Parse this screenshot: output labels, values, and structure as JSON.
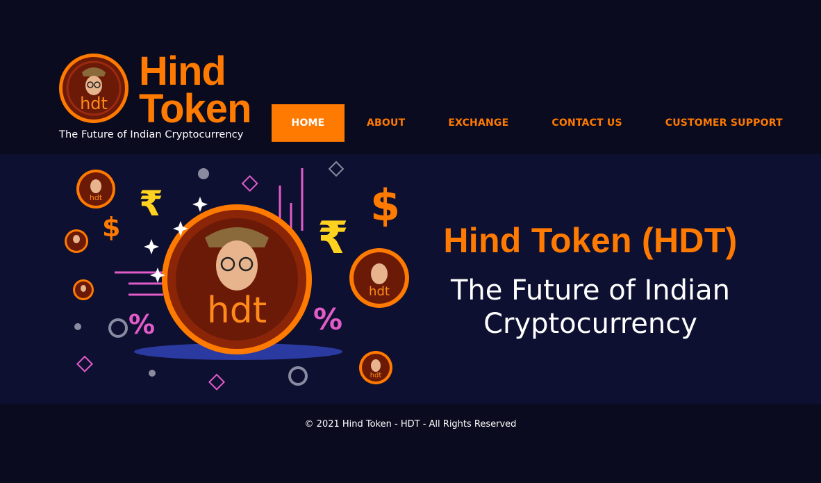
{
  "brand": {
    "logo_line1": "Hind",
    "logo_line2": "Token",
    "coin_text": "hdt",
    "tagline": "The Future of Indian Cryptocurrency",
    "accent_color": "#ff7a00",
    "coin_dark": "#6b1a08"
  },
  "nav": {
    "items": [
      {
        "label": "HOME",
        "active": true
      },
      {
        "label": "ABOUT"
      },
      {
        "label": "EXCHANGE"
      },
      {
        "label": "CONTACT US"
      },
      {
        "label": "CUSTOMER SUPPORT"
      }
    ]
  },
  "hero": {
    "title": "Hind Token (HDT)",
    "subtitle_line1": "The Future of Indian",
    "subtitle_line2": "Cryptocurrency",
    "art": {
      "coin_text": "hdt",
      "rupee_symbol": "₹",
      "dollar_symbol": "$",
      "percent_symbol": "%"
    }
  },
  "footer": {
    "copyright": "© 2021 Hind Token - HDT - All Rights Reserved"
  },
  "colors": {
    "page_bg": "#0b0b1f",
    "hero_bg": "#0e1032",
    "text": "#ffffff",
    "pink": "#e15cc8",
    "gold": "#ffd21f"
  }
}
